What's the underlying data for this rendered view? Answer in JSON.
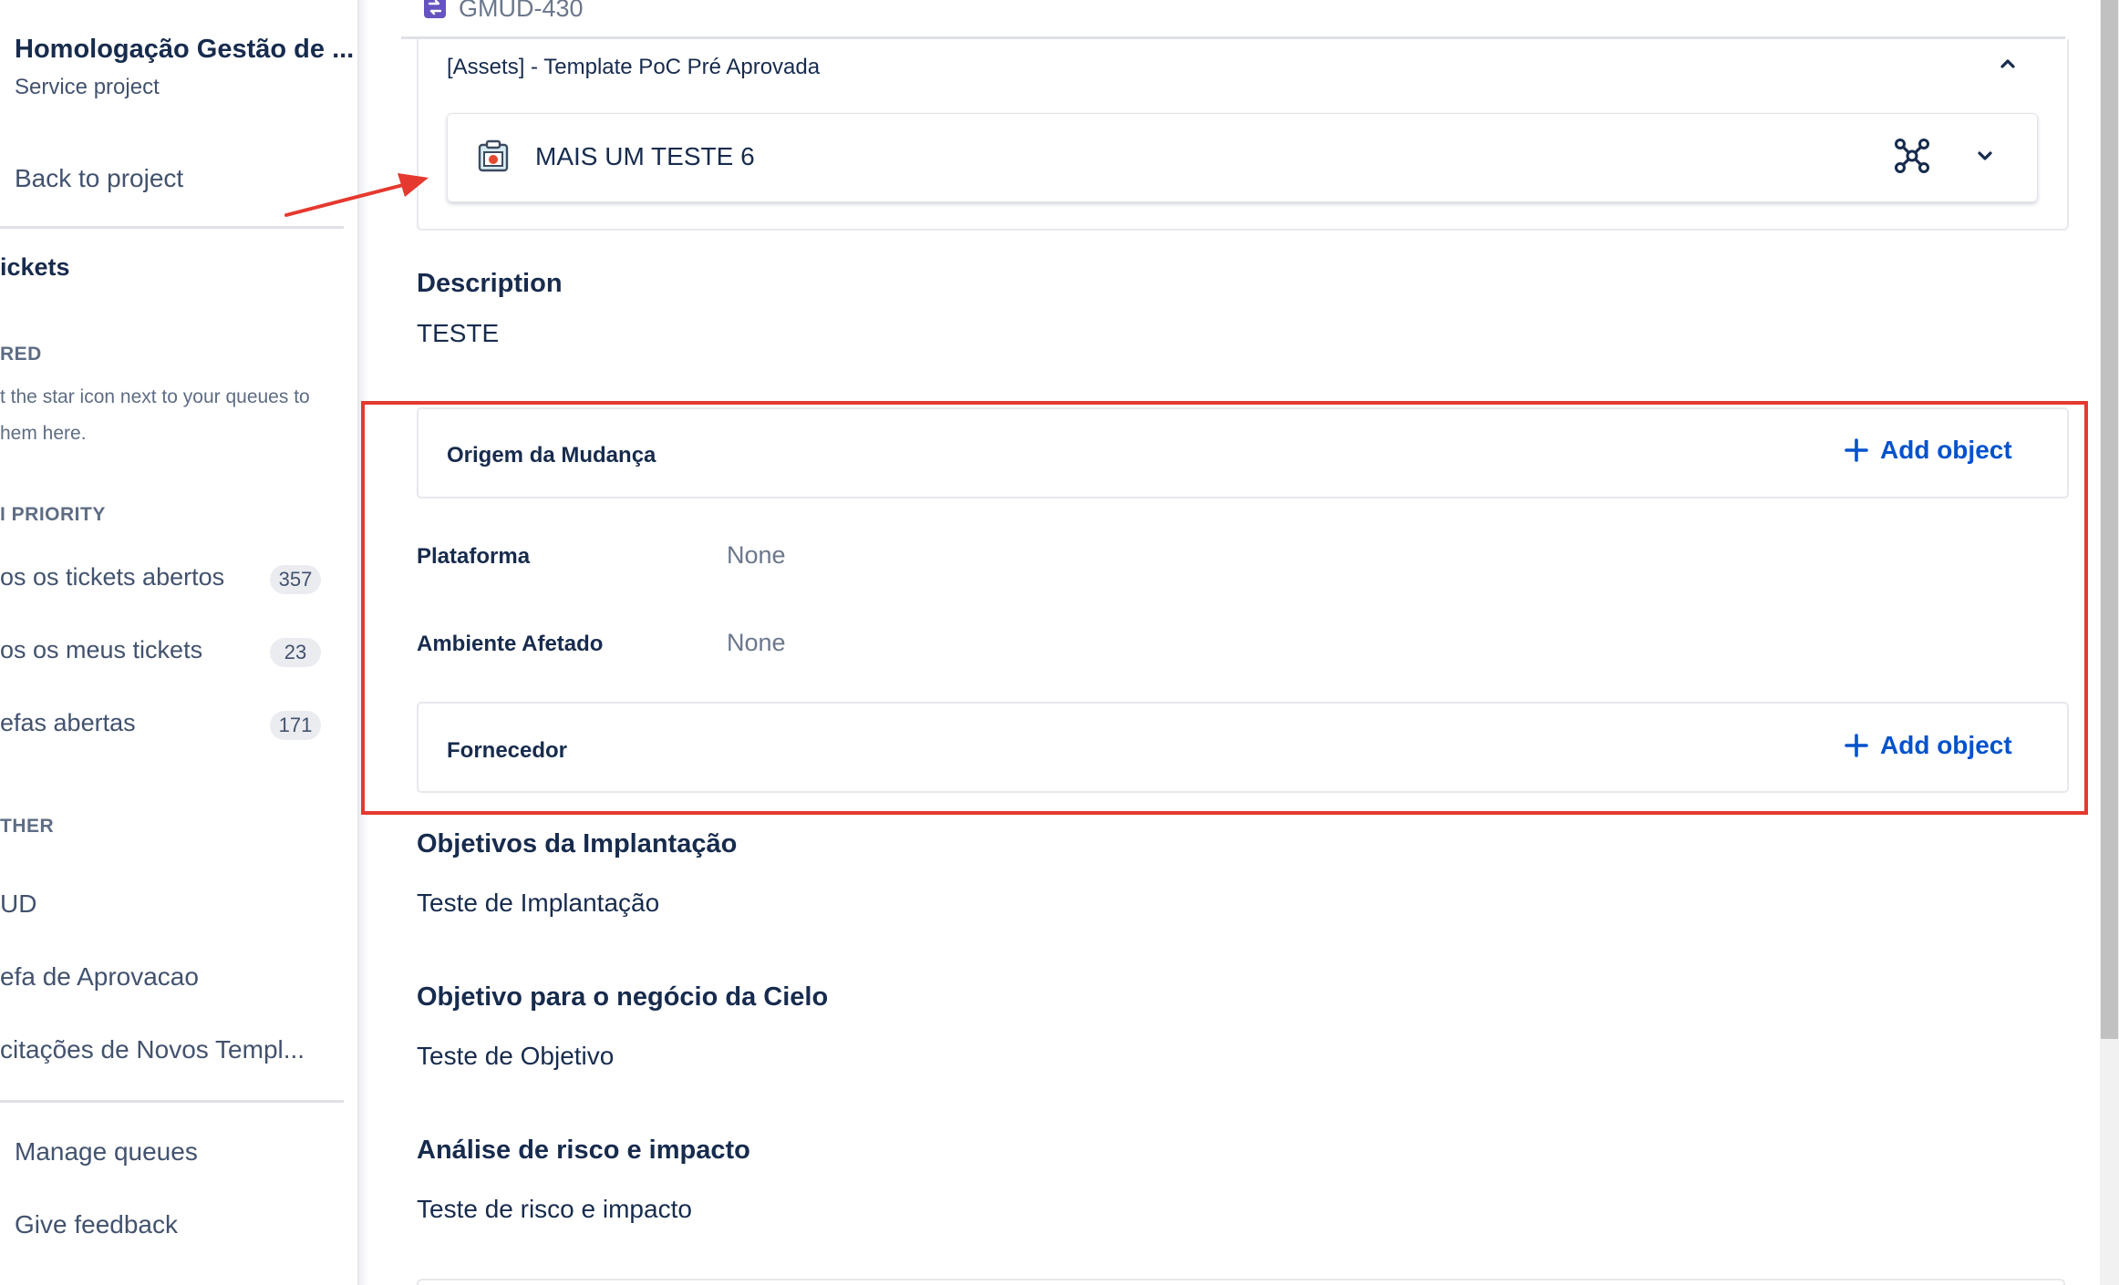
{
  "sidebar": {
    "project_title": "Homologação Gestão de ...",
    "project_type": "Service project",
    "back_link": "Back to project",
    "tickets_header": "ickets",
    "starred_caption": "RED",
    "starred_help_line1": "t the star icon next to your queues to",
    "starred_help_line2": "hem here.",
    "priority_caption": "I PRIORITY",
    "queues": [
      {
        "label": "os os tickets abertos",
        "count": "357"
      },
      {
        "label": "os os meus tickets",
        "count": "23"
      },
      {
        "label": "efas abertas",
        "count": "171"
      }
    ],
    "other_caption": "THER",
    "other_items": [
      "UD",
      "efa de Aprovacao",
      "citações de Novos Templ..."
    ],
    "manage_queues": "Manage queues",
    "give_feedback": "Give feedback"
  },
  "issue": {
    "key": "GMUD-430"
  },
  "assets_panel": {
    "title": "[Assets] - Template PoC Pré Aprovada",
    "object_name": "MAIS UM TESTE 6"
  },
  "description": {
    "label": "Description",
    "value": "TESTE"
  },
  "fields": {
    "origem": {
      "label": "Origem da Mudança",
      "action": "Add object"
    },
    "plataforma": {
      "label": "Plataforma",
      "value": "None"
    },
    "ambiente": {
      "label": "Ambiente Afetado",
      "value": "None"
    },
    "fornecedor": {
      "label": "Fornecedor",
      "action": "Add object"
    }
  },
  "sections": [
    {
      "label": "Objetivos da Implantação",
      "value": "Teste de Implantação"
    },
    {
      "label": "Objetivo para o negócio da Cielo",
      "value": "Teste de Objetivo"
    },
    {
      "label": "Análise de risco e impacto",
      "value": "Teste de risco e impacto"
    }
  ],
  "colors": {
    "accent": "#0052cc",
    "annotation_red": "#e5392f",
    "issue_type_purple": "#6554c0"
  },
  "icons": {
    "issue_type": "change-issue-type-icon",
    "object": "object-type-icon",
    "graph": "graph-view-icon",
    "expand": "chevron-down-icon",
    "collapse": "chevron-up-icon",
    "add": "plus-icon"
  }
}
